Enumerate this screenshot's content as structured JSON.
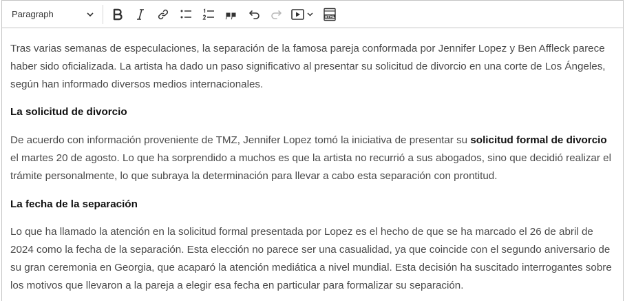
{
  "toolbar": {
    "heading_value": "Paragraph",
    "buttons": [
      "bold-icon",
      "italic-icon",
      "link-icon",
      "bulleted-list-icon",
      "numbered-list-icon",
      "blockquote-icon",
      "undo-icon",
      "redo-icon",
      "media-embed-icon",
      "html-embed-icon"
    ],
    "html_label": "HTML"
  },
  "content": {
    "p1": "Tras varias semanas de especulaciones, la separación de la famosa pareja conformada por Jennifer Lopez y Ben Affleck parece haber sido oficializada. La artista ha dado un paso significativo al presentar su solicitud de divorcio en una corte de Los Ángeles, según han informado diversos medios internacionales.",
    "h1": "La solicitud de divorcio",
    "p2_before": "De acuerdo con información proveniente de TMZ, Jennifer Lopez tomó la iniciativa de presentar su ",
    "p2_bold": "solicitud formal de divorcio",
    "p2_after": " el martes 20 de agosto. Lo que ha sorprendido a muchos es que la artista no recurrió a sus abogados, sino que decidió realizar el trámite personalmente, lo que subraya la determinación para llevar a cabo esta separación con prontitud.",
    "h2": "La fecha de la separación",
    "p3": "Lo que ha llamado la atención en la solicitud formal presentada por Lopez es el hecho de que se ha marcado el 26 de abril de 2024 como la fecha de la separación. Esta elección no parece ser una casualidad, ya que coincide con el segundo aniversario de su gran ceremonia en Georgia, que acaparó la atención mediática a nivel mundial. Esta decisión ha suscitado interrogantes sobre los motivos que llevaron a la pareja a elegir esa fecha en particular para formalizar su separación."
  }
}
